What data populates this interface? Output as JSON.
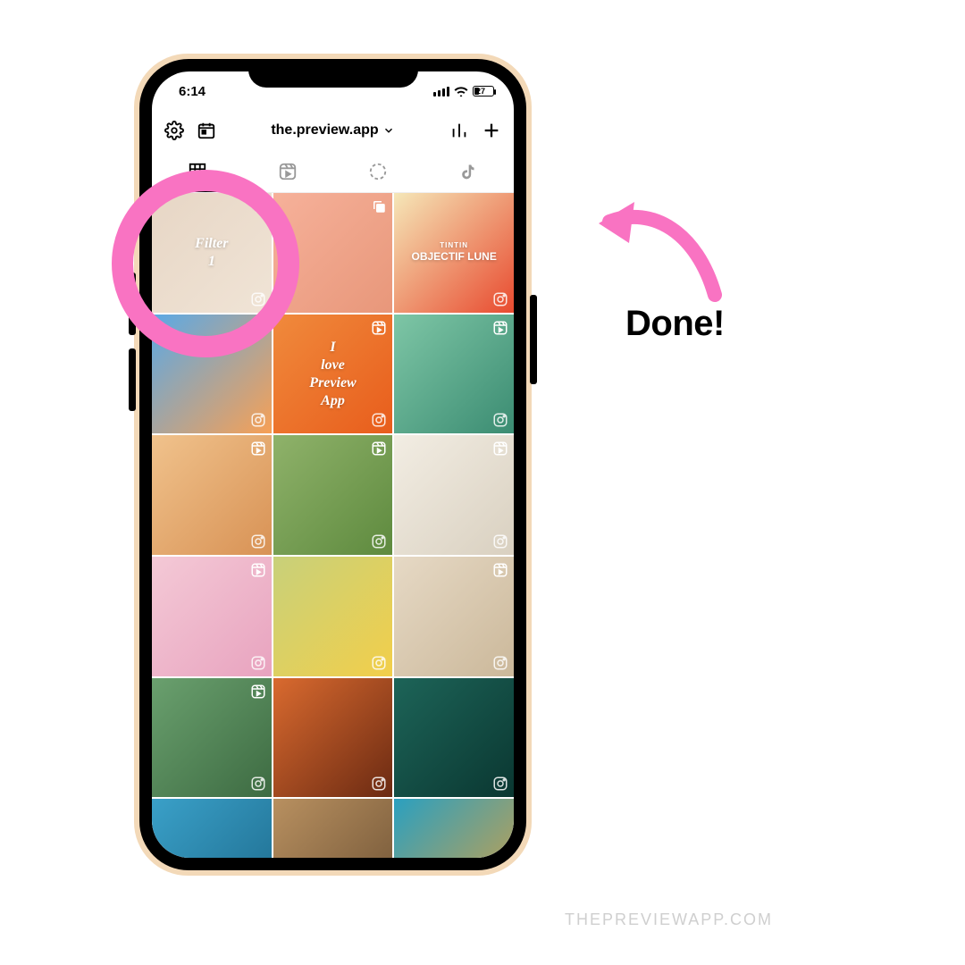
{
  "status": {
    "time": "6:14",
    "battery_pct": "27"
  },
  "header": {
    "username": "the.preview.app",
    "icons": {
      "settings": "gear-icon",
      "calendar": "calendar-icon",
      "chevron": "chevron-down-icon",
      "stats": "stats-icon",
      "add": "plus-icon"
    }
  },
  "tabs": {
    "grid": "grid-icon",
    "reels": "reels-icon",
    "stories": "stories-circle-icon",
    "tiktok": "tiktok-icon"
  },
  "posts": [
    {
      "type": "carousel",
      "text": "Filter 1",
      "colors": [
        "#e7d6c5",
        "#f0e4d6"
      ],
      "ig": true
    },
    {
      "type": "carousel",
      "text": "",
      "colors": [
        "#f6b19a",
        "#e8977a"
      ],
      "ig": false
    },
    {
      "type": "image",
      "text": "OBJECTIF LUNE",
      "colors": [
        "#f5e7b8",
        "#e84a2f"
      ],
      "ig": true,
      "sub": "TINTIN"
    },
    {
      "type": "image",
      "text": "",
      "colors": [
        "#5aa9e6",
        "#f7a055"
      ],
      "ig": true
    },
    {
      "type": "reel",
      "text": "I love Preview App",
      "colors": [
        "#f08a3c",
        "#e85d1c"
      ],
      "ig": true
    },
    {
      "type": "reel",
      "text": "",
      "colors": [
        "#7ec6a6",
        "#3b8c72"
      ],
      "ig": true
    },
    {
      "type": "reel",
      "text": "",
      "colors": [
        "#f0c28c",
        "#d89255"
      ],
      "ig": true
    },
    {
      "type": "reel",
      "text": "",
      "colors": [
        "#8fb26a",
        "#5e8a3e"
      ],
      "ig": true
    },
    {
      "type": "reel",
      "text": "",
      "colors": [
        "#f2ede3",
        "#d9d0c0"
      ],
      "ig": true
    },
    {
      "type": "reel",
      "text": "",
      "colors": [
        "#f4c9d6",
        "#e8a3bf"
      ],
      "ig": true
    },
    {
      "type": "image",
      "text": "",
      "colors": [
        "#c8d07a",
        "#f2cf4a"
      ],
      "ig": true
    },
    {
      "type": "reel",
      "text": "",
      "colors": [
        "#e6d9c5",
        "#cbb89a"
      ],
      "ig": true
    },
    {
      "type": "reel",
      "text": "",
      "colors": [
        "#6aa06e",
        "#3d6b42"
      ],
      "ig": true
    },
    {
      "type": "image",
      "text": "",
      "colors": [
        "#d96a2f",
        "#6b2a12"
      ],
      "ig": true
    },
    {
      "type": "image",
      "text": "",
      "colors": [
        "#1d6458",
        "#0a3731"
      ],
      "ig": true
    },
    {
      "type": "image",
      "text": "",
      "colors": [
        "#3aa0c8",
        "#1d6a8c"
      ],
      "ig": false
    },
    {
      "type": "image",
      "text": "",
      "colors": [
        "#b89060",
        "#6e5234"
      ],
      "ig": false
    },
    {
      "type": "image",
      "text": "",
      "colors": [
        "#2aa0c0",
        "#d9a040"
      ],
      "ig": false
    }
  ],
  "annotation": {
    "label": "Done!"
  },
  "watermark": "THEPREVIEWAPP.COM",
  "colors": {
    "accent_pink": "#f973c2"
  }
}
